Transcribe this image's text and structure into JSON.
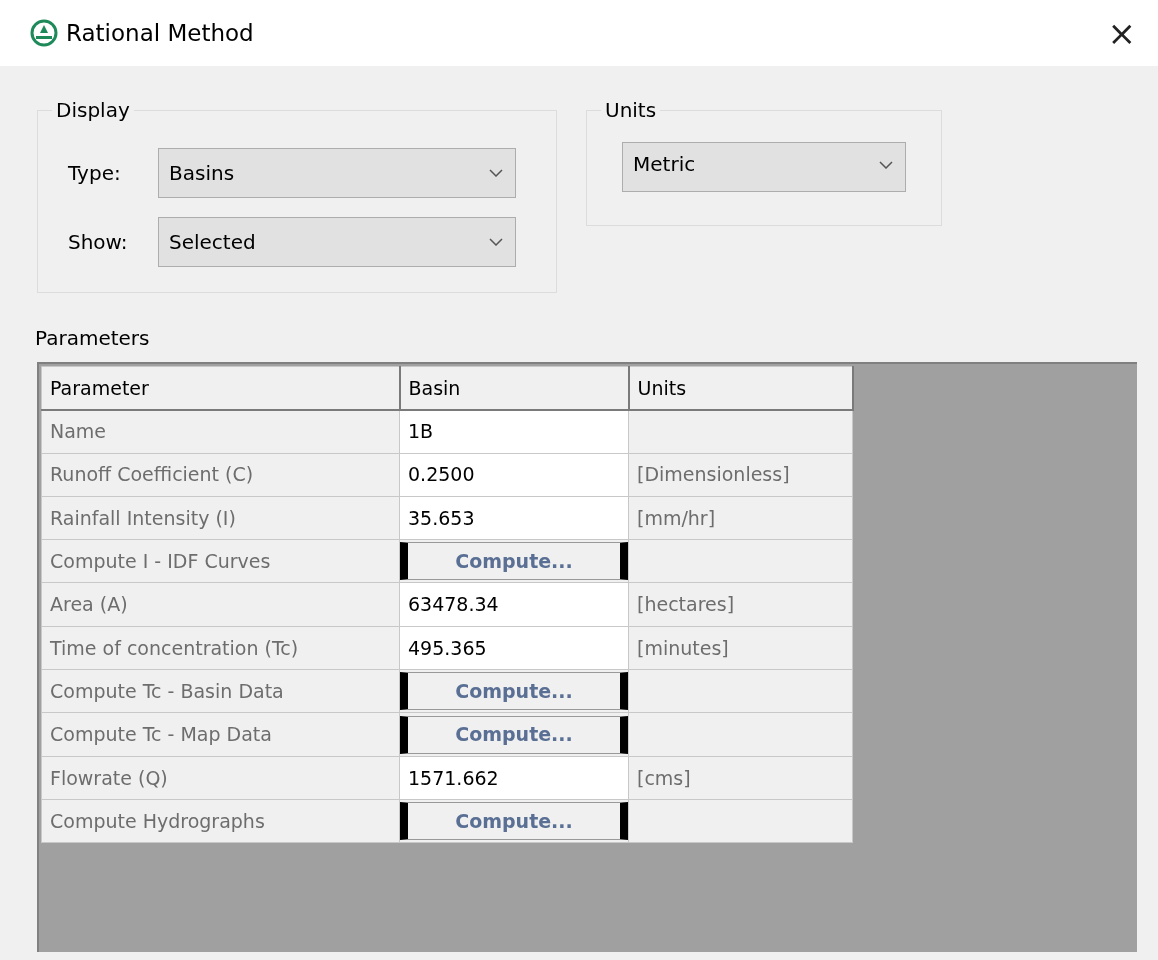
{
  "window": {
    "title": "Rational Method",
    "close": "×"
  },
  "display": {
    "legend": "Display",
    "type_label": "Type:",
    "type_value": "Basins",
    "show_label": "Show:",
    "show_value": "Selected"
  },
  "units": {
    "legend": "Units",
    "value": "Metric"
  },
  "parameters": {
    "label": "Parameters",
    "columns": [
      "Parameter",
      "Basin",
      "Units"
    ],
    "rows": [
      {
        "kind": "value",
        "parameter": "Name",
        "basin": "1B"
      },
      {
        "kind": "value",
        "parameter": "Runoff Coefficient (C)",
        "basin": "0.2500",
        "units": "[Dimensionless]"
      },
      {
        "kind": "value",
        "parameter": "Rainfall Intensity (I)",
        "basin": "35.653",
        "units": "[mm/hr]"
      },
      {
        "kind": "button",
        "parameter": "Compute I - IDF Curves",
        "basin": "Compute..."
      },
      {
        "kind": "value",
        "parameter": "Area (A)",
        "basin": "63478.34",
        "units": "[hectares]"
      },
      {
        "kind": "value",
        "parameter": "Time of concentration (Tc)",
        "basin": "495.365",
        "units": "[minutes]"
      },
      {
        "kind": "button",
        "parameter": "Compute Tc - Basin Data",
        "basin": "Compute..."
      },
      {
        "kind": "button",
        "parameter": "Compute Tc - Map Data",
        "basin": "Compute..."
      },
      {
        "kind": "value",
        "parameter": "Flowrate (Q)",
        "basin": "1571.662",
        "units": "[cms]"
      },
      {
        "kind": "button",
        "parameter": "Compute Hydrographs",
        "basin": "Compute..."
      }
    ]
  }
}
